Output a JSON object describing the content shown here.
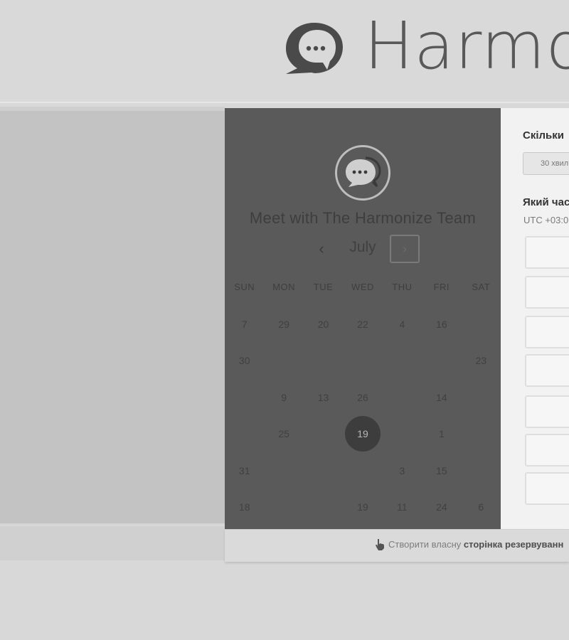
{
  "header": {
    "brand_name": "Harmo"
  },
  "card": {
    "title": "Meet with The Harmonize Team",
    "month": "July",
    "prev_symbol": "‹",
    "next_symbol": "›",
    "weekdays": [
      "SUN",
      "MON",
      "TUE",
      "WED",
      "THU",
      "FRI",
      "SAT"
    ],
    "days": [
      [
        "7",
        "29",
        "20",
        "22",
        "4",
        "16",
        ""
      ],
      [
        "30",
        "",
        "",
        "",
        "",
        "",
        "23"
      ],
      [
        "",
        "9",
        "13",
        "26",
        "",
        "14",
        ""
      ],
      [
        "",
        "25",
        "",
        "19",
        "",
        "1",
        ""
      ],
      [
        "31",
        "",
        "",
        "",
        "3",
        "15",
        ""
      ],
      [
        "18",
        "",
        "",
        "19",
        "11",
        "24",
        "6"
      ]
    ],
    "selected_day": "19"
  },
  "booking": {
    "duration_question": "Скільки",
    "duration_value": "30 хвил",
    "time_question": "Який час",
    "timezone": "UTC +03:0"
  },
  "footer": {
    "text_prefix": "Створити власну",
    "text_bold": "сторінка резервуванн"
  },
  "colors": {
    "page_background": "#d8d8d8",
    "card_dark": "#5a5a5a",
    "selected_circle": "#3d3d3d",
    "panel_white": "#f2f2f2"
  },
  "icons": {
    "brand": "chat-bubble-logo",
    "team": "chat-bubble-logo",
    "footer": "pointer-hand-icon"
  }
}
